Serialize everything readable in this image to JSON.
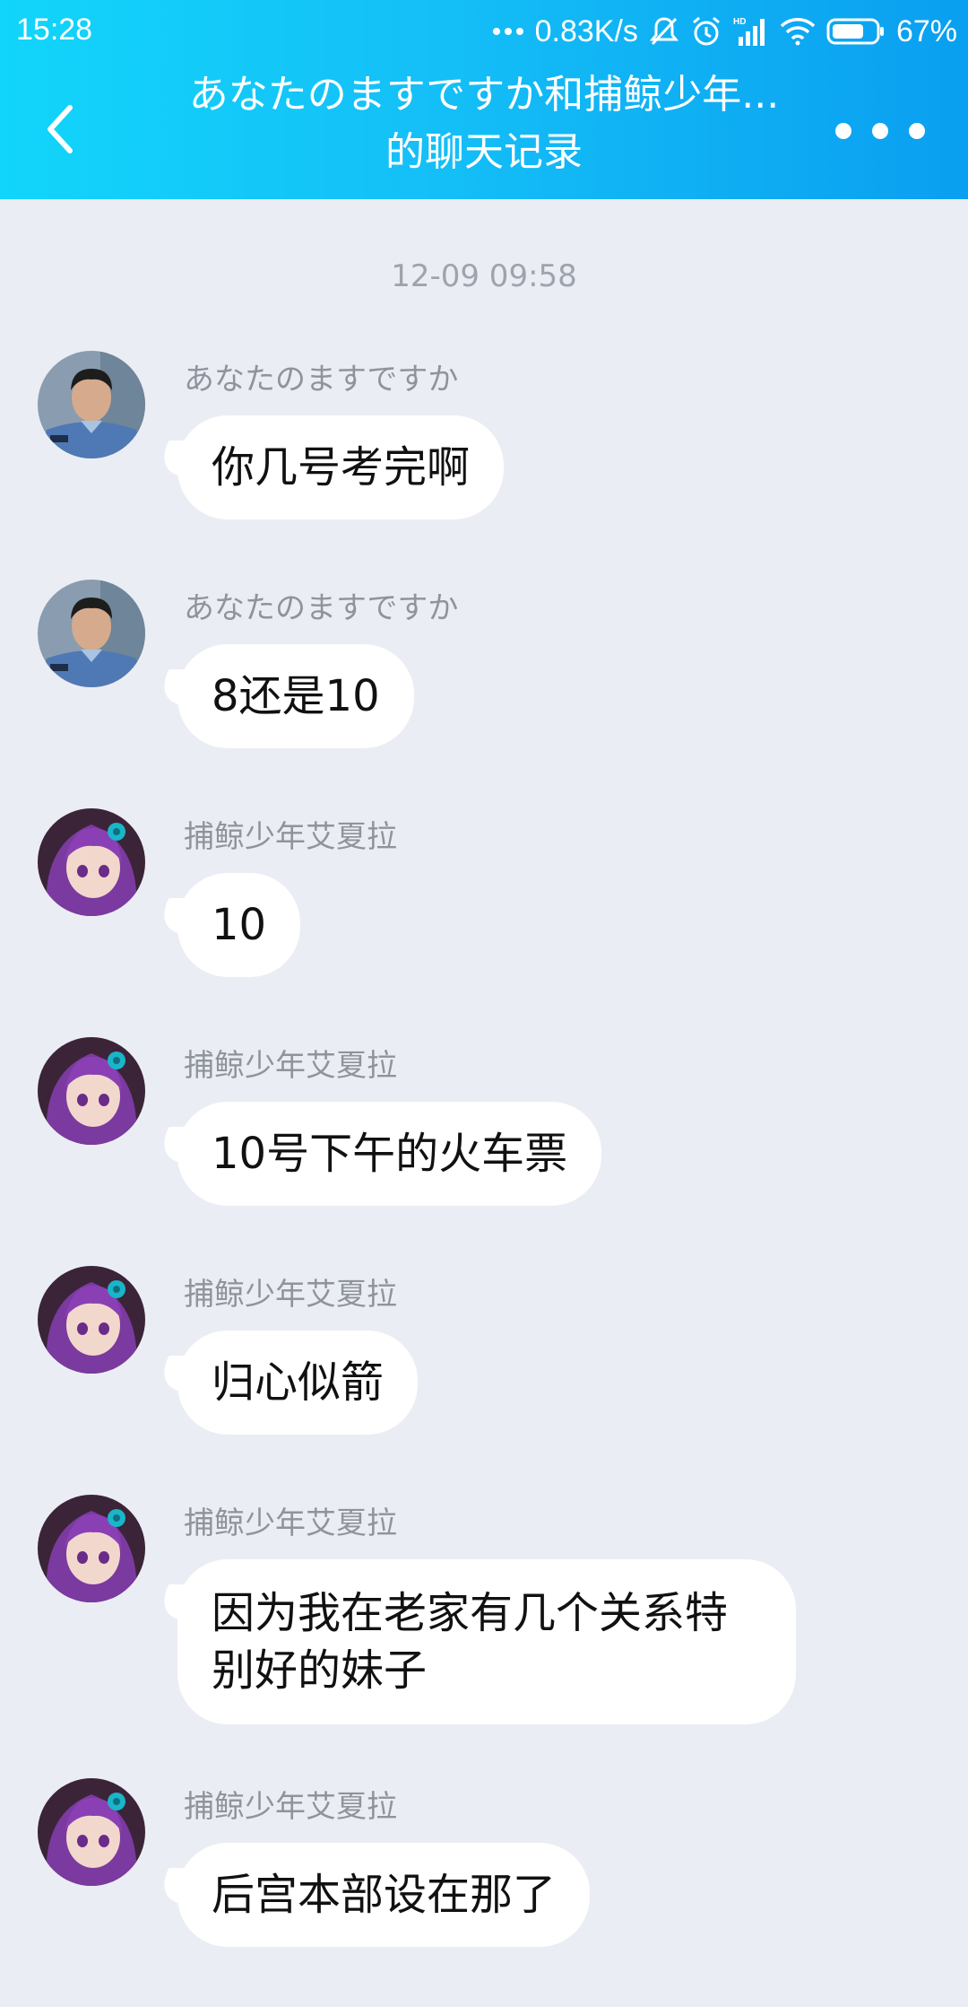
{
  "status_bar": {
    "time": "15:28",
    "network_speed": "0.83K/s",
    "battery": "67%",
    "icons": [
      "dots-icon",
      "mute-icon",
      "alarm-icon",
      "hd-signal-icon",
      "wifi-icon",
      "battery-icon"
    ]
  },
  "header": {
    "title": "あなたのますですか和捕鲸少年...的聊天记录",
    "back_icon": "chevron-left-icon",
    "more_icon": "more-dots-icon"
  },
  "colors": {
    "header_gradient_start": "#12d5fb",
    "header_gradient_end": "#0a9ff0",
    "background": "#ebedf4",
    "bubble": "#ffffff"
  },
  "chat": {
    "timestamp": "12-09 09:58",
    "messages": [
      {
        "sender": "あなたのますですか",
        "text": "你几号考完啊",
        "avatar": "police-avatar"
      },
      {
        "sender": "あなたのますですか",
        "text": "8还是10",
        "avatar": "police-avatar"
      },
      {
        "sender": "捕鲸少年艾夏拉",
        "text": "10",
        "avatar": "anime-girl-avatar"
      },
      {
        "sender": "捕鲸少年艾夏拉",
        "text": "10号下午的火车票",
        "avatar": "anime-girl-avatar"
      },
      {
        "sender": "捕鲸少年艾夏拉",
        "text": "归心似箭",
        "avatar": "anime-girl-avatar"
      },
      {
        "sender": "捕鲸少年艾夏拉",
        "text": "因为我在老家有几个关系特别好的妹子",
        "avatar": "anime-girl-avatar"
      },
      {
        "sender": "捕鲸少年艾夏拉",
        "text": "后宫本部设在那了",
        "avatar": "anime-girl-avatar"
      }
    ]
  }
}
